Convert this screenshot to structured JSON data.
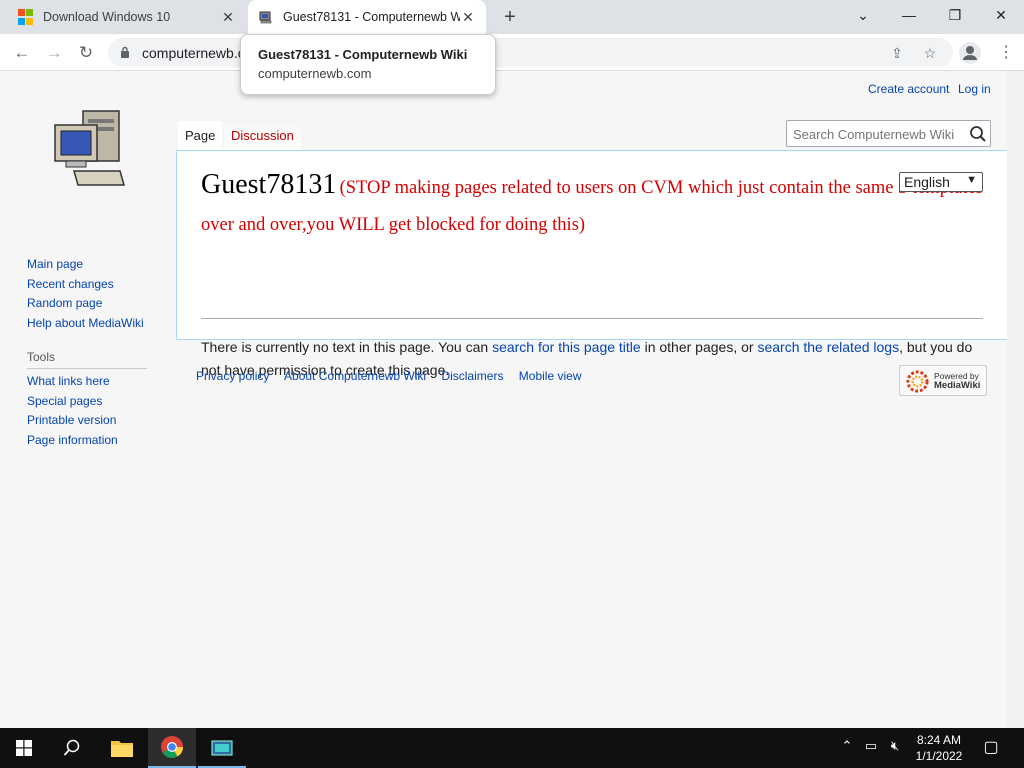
{
  "browser": {
    "tabs": [
      {
        "title": "Download Windows 10",
        "icon": "windows-logo-icon"
      },
      {
        "title": "Guest78131 - Computernewb Wi",
        "icon": "computer-favicon-icon"
      }
    ],
    "url_visible": "computernewb.c",
    "tooltip": {
      "title": "Guest78131 - Computernewb Wiki",
      "domain": "computernewb.com"
    }
  },
  "page": {
    "personal_tools": {
      "create_account": "Create account",
      "login": "Log in"
    },
    "tabs": {
      "page": "Page",
      "discussion": "Discussion"
    },
    "search_placeholder": "Search Computernewb Wiki",
    "navigation": [
      "Main page",
      "Recent changes",
      "Random page",
      "Help about MediaWiki"
    ],
    "tools_heading": "Tools",
    "tools": [
      "What links here",
      "Special pages",
      "Printable version",
      "Page information"
    ],
    "title_main": "Guest78131",
    "title_sub": "(STOP making pages related to users on CVM which just contain the same 3 templates over and over,you WILL get blocked for doing this)",
    "language": "English",
    "body": {
      "t1": "There is currently no text in this page. You can ",
      "link1": "search for this page title",
      "t2": " in other pages, or ",
      "link2": "search the related logs",
      "t3": ", but you do not have permission to create this page."
    },
    "footer": [
      "Privacy policy",
      "About Computernewb Wiki",
      "Disclaimers",
      "Mobile view"
    ],
    "powered": {
      "line1": "Powered by",
      "line2": "MediaWiki"
    }
  },
  "taskbar": {
    "time": "8:24 AM",
    "date": "1/1/2022"
  },
  "colors": {
    "link": "#0645ad",
    "red_title": "#d40000",
    "discussion": "#ba0000"
  }
}
